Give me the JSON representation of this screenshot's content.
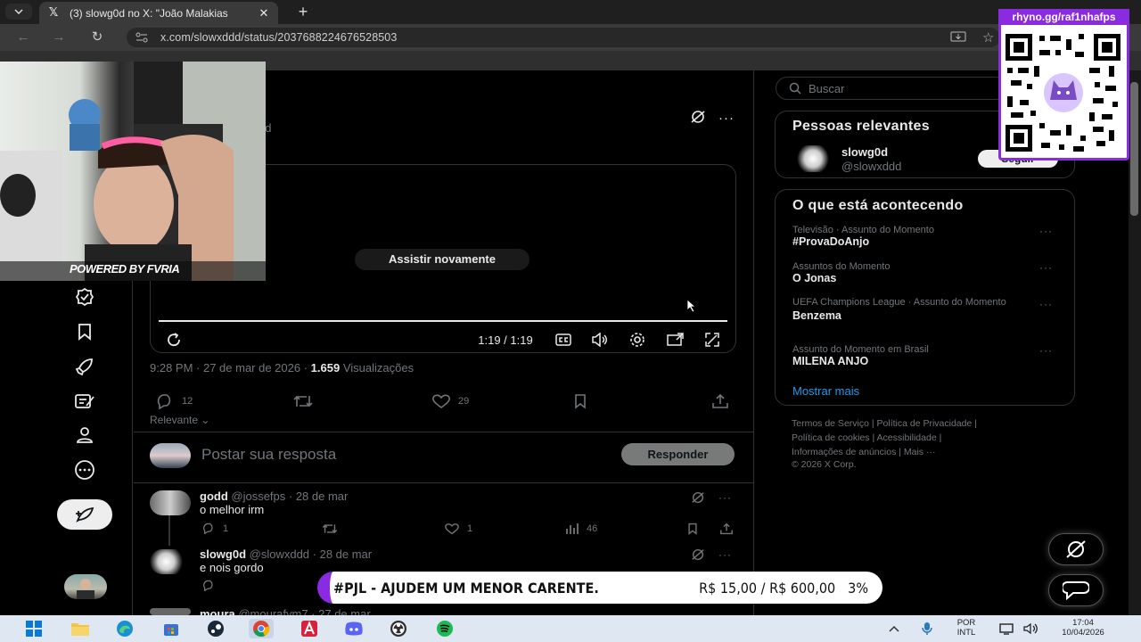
{
  "browser": {
    "tab_title": "(3) slowg0d no X: \"João Malakias",
    "tab_close": "✕",
    "new_tab": "+",
    "url": "x.com/slowxddd/status/2037688224676528503"
  },
  "post": {
    "author_handle_partial": "dd",
    "replay_label": "Assistir novamente",
    "video_time": "1:19 / 1:19",
    "timestamp": "9:28 PM · 27 de mar de 2026 · ",
    "views_count": "1.659",
    "views_label": " Visualizações",
    "actions": {
      "replies": "12",
      "likes": "29"
    },
    "sort_label": "Relevante",
    "reply_placeholder": "Postar sua resposta",
    "reply_button": "Responder"
  },
  "replies": [
    {
      "name": "godd",
      "handle": "@jossefps · 28 de mar",
      "text": "o melhor irm",
      "replies": "1",
      "likes": "1",
      "views": "46"
    },
    {
      "name": "slowg0d",
      "handle": "@slowxddd · 28 de mar",
      "text": "e nois gordo"
    },
    {
      "name": "moura",
      "handle": "@mourafym7 · 27 de mar"
    }
  ],
  "sidebar": {
    "search_placeholder": "Buscar",
    "people_title": "Pessoas relevantes",
    "person_name": "slowg0d",
    "person_handle": "@slowxddd",
    "follow_label": "Seguir",
    "trends_title": "O que está acontecendo",
    "trends": [
      {
        "category": "Televisão · Assunto do Momento",
        "name": "#ProvaDoAnjo"
      },
      {
        "category": "Assuntos do Momento",
        "name": "O Jonas"
      },
      {
        "category": "UEFA Champions League · Assunto do Momento",
        "name": "Benzema"
      },
      {
        "category": "Assunto do Momento em Brasil",
        "name": "MILENA ANJO"
      }
    ],
    "show_more": "Mostrar mais",
    "footer": {
      "terms": "Termos de Serviço",
      "privacy": "Política de Privacidade",
      "cookies": "Política de cookies",
      "accessibility": "Acessibilidade",
      "ads": "Informações de anúncios",
      "more": "Mais ···",
      "copyright": "© 2026 X Corp."
    }
  },
  "overlay": {
    "webcam_caption": "POWERED BY FVRIA",
    "qr_label": "rhyno.gg/raf1nhafps",
    "donation_text": "#PJL - AJUDEM UM MENOR CARENTE.",
    "donation_goal": "R$ 15,00 / R$ 600,00",
    "donation_percent": "3%",
    "donation_progress": 0.03
  },
  "taskbar": {
    "lang_line1": "POR",
    "lang_line2": "INTL",
    "time": "17:04",
    "date": "10/04/2026"
  },
  "colors": {
    "accent": "#1d9bf0",
    "brand_overlay": "#8a2be2",
    "background": "#000000"
  }
}
